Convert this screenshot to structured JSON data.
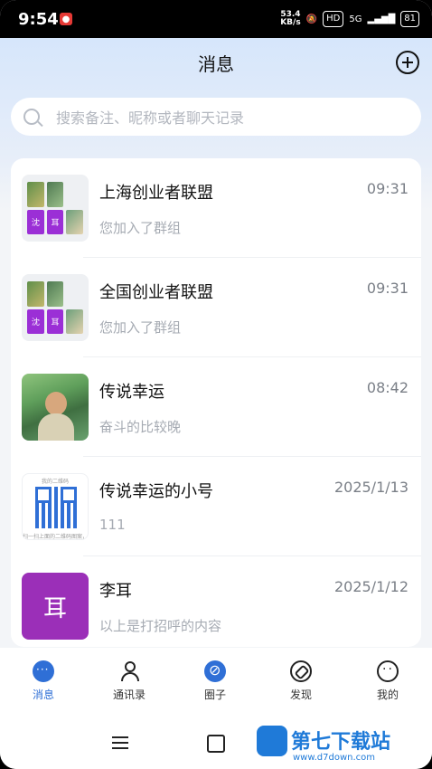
{
  "status_bar": {
    "time": "9:54",
    "net_speed_top": "53.4",
    "net_speed_bottom": "KB/s",
    "hd": "HD",
    "signal": "5G",
    "battery": "81"
  },
  "header": {
    "title": "消息"
  },
  "search": {
    "placeholder": "搜索备注、昵称或者聊天记录"
  },
  "conversations": [
    {
      "name": "上海创业者联盟",
      "time": "09:31",
      "preview": "您加入了群组",
      "avatar_cells": [
        "沈",
        "耳"
      ]
    },
    {
      "name": "全国创业者联盟",
      "time": "09:31",
      "preview": "您加入了群组",
      "avatar_cells": [
        "沈",
        "耳"
      ]
    },
    {
      "name": "传说幸运",
      "time": "08:42",
      "preview": "奋斗的比较晚"
    },
    {
      "name": "传说幸运的小号",
      "time": "2025/1/13",
      "preview": "111",
      "qr_title": "我的二维码",
      "qr_caption": "扫一扫上面的二维码图案，加我为好友"
    },
    {
      "name": "李耳",
      "time": "2025/1/12",
      "preview": "以上是打招呼的内容",
      "avatar_text": "耳"
    }
  ],
  "tabs": [
    {
      "label": "消息",
      "icon": "chat-icon",
      "active": true
    },
    {
      "label": "通讯录",
      "icon": "contacts-icon"
    },
    {
      "label": "圈子",
      "icon": "circle-icon"
    },
    {
      "label": "发现",
      "icon": "compass-icon"
    },
    {
      "label": "我的",
      "icon": "profile-icon"
    }
  ],
  "watermark": {
    "text": "第七下载站",
    "url": "www.d7down.com"
  }
}
